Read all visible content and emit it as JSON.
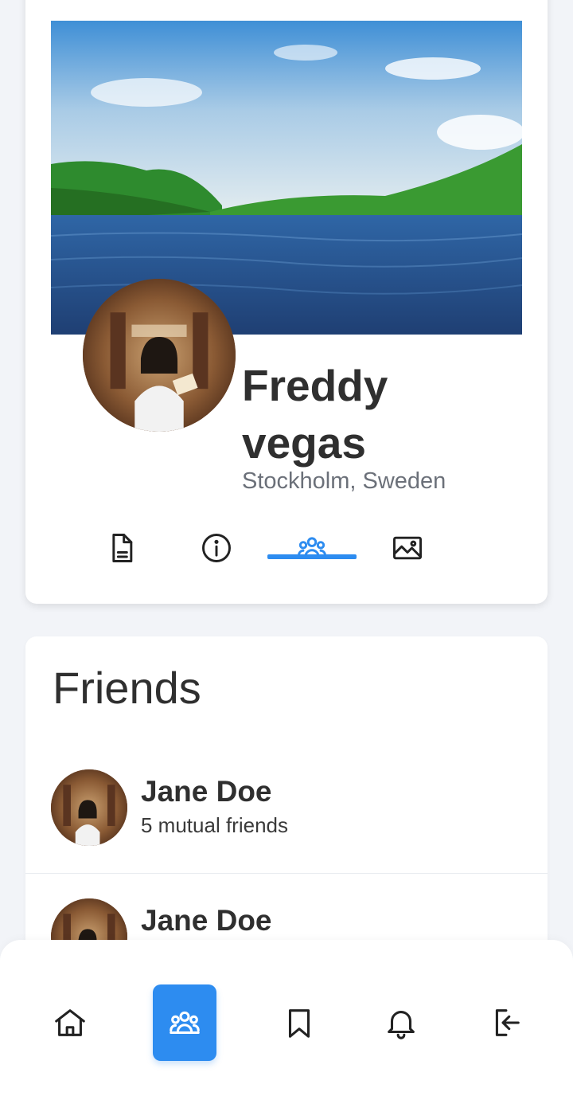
{
  "profile": {
    "name": "Freddy vegas",
    "location": "Stockholm, Sweden",
    "tabs": [
      {
        "icon": "document-icon",
        "active": false
      },
      {
        "icon": "info-icon",
        "active": false
      },
      {
        "icon": "friends-icon",
        "active": true
      },
      {
        "icon": "image-icon",
        "active": false
      }
    ]
  },
  "friends": {
    "title": "Friends",
    "items": [
      {
        "name": "Jane Doe",
        "meta": "5 mutual friends"
      },
      {
        "name": "Jane Doe",
        "meta": ""
      }
    ]
  },
  "bottom_nav": {
    "items": [
      {
        "icon": "home-icon",
        "active": false
      },
      {
        "icon": "friends-icon",
        "active": true
      },
      {
        "icon": "bookmark-icon",
        "active": false
      },
      {
        "icon": "bell-icon",
        "active": false
      },
      {
        "icon": "logout-icon",
        "active": false
      }
    ]
  },
  "colors": {
    "accent": "#2d8cf0",
    "background": "#f2f4f8",
    "card": "#ffffff",
    "text": "#2f2f2f",
    "muted": "#6b7079"
  }
}
